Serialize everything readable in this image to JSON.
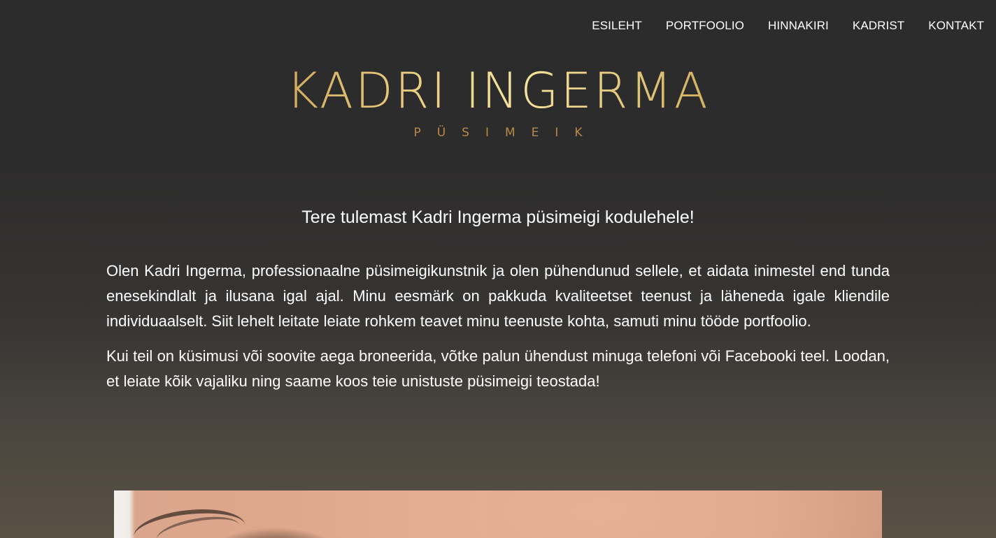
{
  "nav": {
    "items": [
      {
        "label": "ESILEHT"
      },
      {
        "label": "PORTFOOLIO"
      },
      {
        "label": "HINNAKIRI"
      },
      {
        "label": "KADRIST"
      },
      {
        "label": "KONTAKT"
      }
    ]
  },
  "logo": {
    "title": "KADRI INGERMA",
    "subtitle": "PÜSIMEIK"
  },
  "main": {
    "welcome": "Tere tulemast Kadri Ingerma püsimeigi kodulehele!",
    "paragraphs": [
      "Olen Kadri Ingerma, professionaalne püsimeigikunstnik ja olen pühendunud sellele, et aidata inimestel end tunda enesekindlalt ja ilusana igal ajal. Minu eesmärk on pakkuda kvaliteetset teenust ja läheneda igale kliendile individuaalselt. Siit lehelt leitate leiate rohkem teavet minu teenuste kohta, samuti minu tööde portfoolio.",
      "Kui teil on küsimusi või soovite aega broneerida, võtke palun ühendust minuga telefoni või Facebooki teel. Loodan, et leiate kõik vajaliku ning saame koos teie unistuste püsimeigi teostada!"
    ]
  },
  "colors": {
    "background_top": "#2c2c2c",
    "background_bottom": "#5a5145",
    "logo_gold_light": "#f5e39e",
    "logo_gold_dark": "#9a6e2c",
    "text": "#ffffff"
  }
}
